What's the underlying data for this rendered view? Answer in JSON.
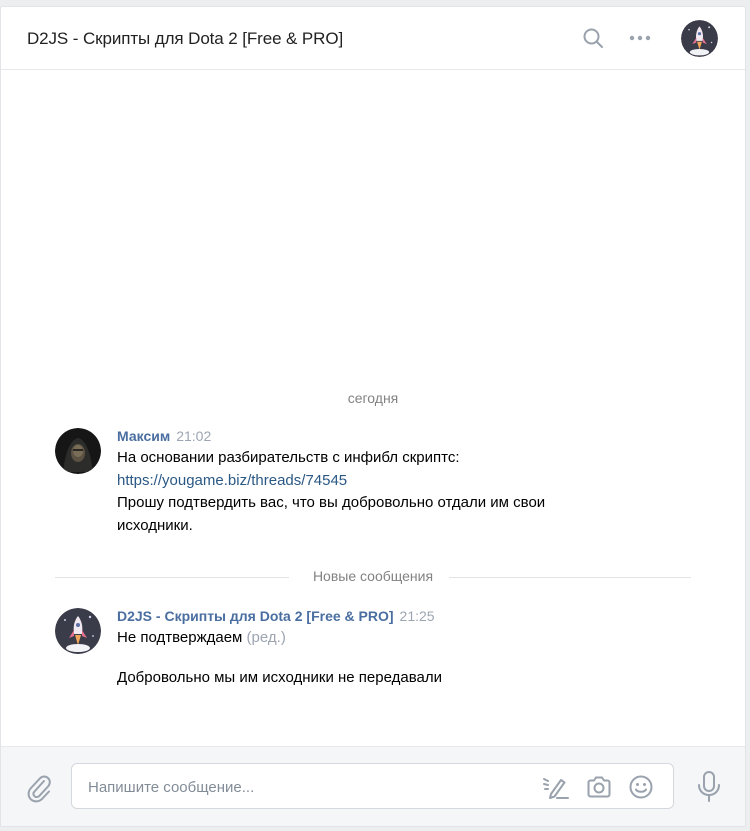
{
  "header": {
    "title": "D2JS - Скрипты для Dota 2 [Free & PRO]"
  },
  "chat": {
    "date_separator": "сегодня",
    "new_messages_separator": "Новые сообщения",
    "messages": [
      {
        "author": "Максим",
        "time": "21:02",
        "lines": [
          "На основании разбирательств с инфибл скриптс:",
          "https://yougame.biz/threads/74545",
          "Прошу подтвердить вас, что вы добровольно отдали им свои",
          "исходники."
        ]
      },
      {
        "author": "D2JS - Скрипты для Dota 2 [Free & PRO]",
        "time": "21:25",
        "lines": [
          "Не подтверждаем",
          "Добровольно мы им исходники не передавали"
        ],
        "edited_label": "(ред.)"
      }
    ]
  },
  "composer": {
    "placeholder": "Напишите сообщение..."
  },
  "colors": {
    "author": "#4a6ea0",
    "link": "#2a5885",
    "muted": "#828282",
    "icon": "#99a2ad"
  },
  "icons": [
    "search-icon",
    "more-icon",
    "attach-icon",
    "graffiti-icon",
    "camera-icon",
    "emoji-icon",
    "microphone-icon"
  ]
}
